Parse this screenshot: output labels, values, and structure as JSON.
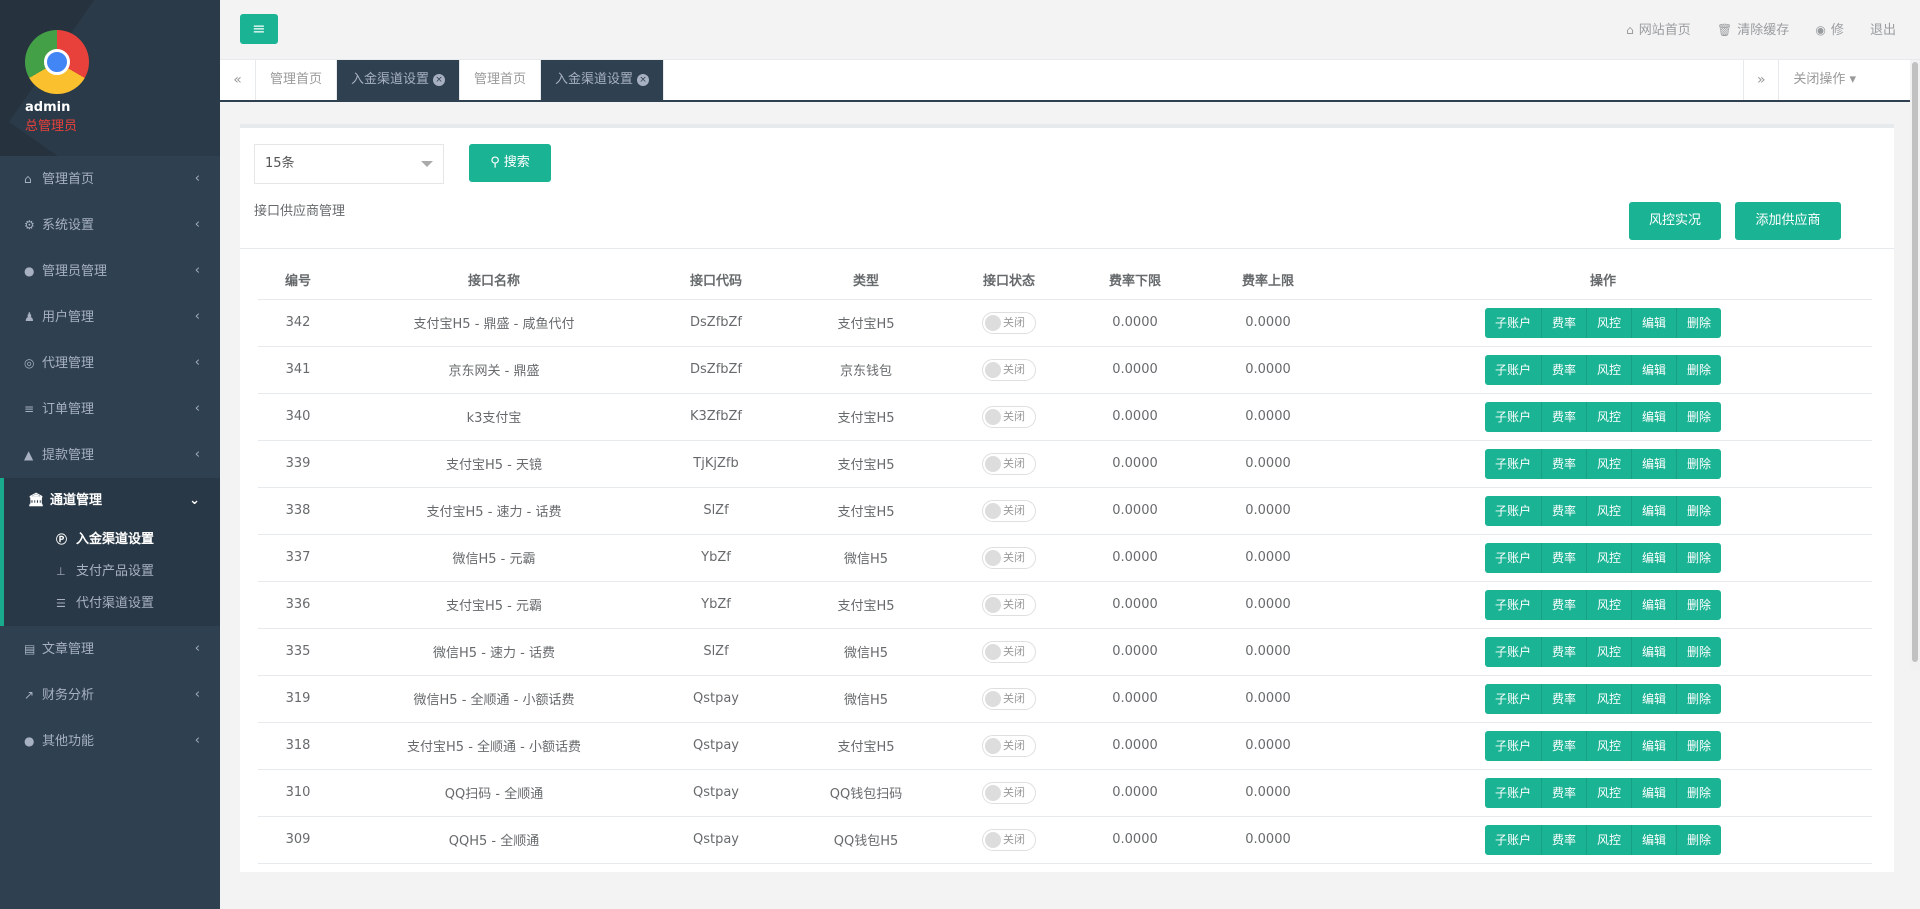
{
  "user": {
    "name": "admin",
    "role": "总管理员"
  },
  "sidebar": {
    "items_top": [
      {
        "label": "管理首页",
        "icon": "home-icon"
      },
      {
        "label": "系统设置",
        "icon": "cogs-icon"
      },
      {
        "label": "管理员管理",
        "icon": "user-circle-icon"
      },
      {
        "label": "用户管理",
        "icon": "users-icon"
      },
      {
        "label": "代理管理",
        "icon": "handshake-icon"
      },
      {
        "label": "订单管理",
        "icon": "list-icon"
      },
      {
        "label": "提款管理",
        "icon": "lock-icon"
      }
    ],
    "active": {
      "label": "通道管理",
      "icon": "bank-icon"
    },
    "sub_items": [
      {
        "label": "入金渠道设置",
        "icon": "paypal-icon"
      },
      {
        "label": "支付产品设置",
        "icon": "sitemap-icon"
      },
      {
        "label": "代付渠道设置",
        "icon": "sliders-icon"
      }
    ],
    "items_bottom": [
      {
        "label": "文章管理",
        "icon": "book-icon"
      },
      {
        "label": "财务分析",
        "icon": "chart-icon"
      },
      {
        "label": "其他功能",
        "icon": "user-circle-icon"
      }
    ]
  },
  "topbar": {
    "home": "网站首页",
    "clear_cache": "清除缓存",
    "edit": "修",
    "logout": "退出"
  },
  "tabs": [
    {
      "label": "管理首页",
      "active": false
    },
    {
      "label": "入金渠道设置",
      "active": true
    },
    {
      "label": "管理首页",
      "active": false
    },
    {
      "label": "入金渠道设置",
      "active": true
    }
  ],
  "tab_ops": "关闭操作",
  "filter": {
    "page_size": "15条",
    "search": "搜索"
  },
  "panel_title": "接口供应商管理",
  "buttons": {
    "risk": "风控实况",
    "add": "添加供应商"
  },
  "columns": [
    "编号",
    "接口名称",
    "接口代码",
    "类型",
    "接口状态",
    "费率下限",
    "费率上限",
    "操作"
  ],
  "status_label": "关闭",
  "actions": [
    "子账户",
    "费率",
    "风控",
    "编辑",
    "删除"
  ],
  "rows": [
    {
      "id": "342",
      "name": "支付宝H5 - 鼎盛 - 咸鱼代付",
      "code": "DsZfbZf",
      "type": "支付宝H5",
      "min": "0.0000",
      "max": "0.0000"
    },
    {
      "id": "341",
      "name": "京东网关 - 鼎盛",
      "code": "DsZfbZf",
      "type": "京东钱包",
      "min": "0.0000",
      "max": "0.0000"
    },
    {
      "id": "340",
      "name": "k3支付宝",
      "code": "K3ZfbZf",
      "type": "支付宝H5",
      "min": "0.0000",
      "max": "0.0000"
    },
    {
      "id": "339",
      "name": "支付宝H5 - 天镜",
      "code": "TjKjZfb",
      "type": "支付宝H5",
      "min": "0.0000",
      "max": "0.0000"
    },
    {
      "id": "338",
      "name": "支付宝H5 - 速力 - 话费",
      "code": "SlZf",
      "type": "支付宝H5",
      "min": "0.0000",
      "max": "0.0000"
    },
    {
      "id": "337",
      "name": "微信H5 - 元霸",
      "code": "YbZf",
      "type": "微信H5",
      "min": "0.0000",
      "max": "0.0000"
    },
    {
      "id": "336",
      "name": "支付宝H5 - 元霸",
      "code": "YbZf",
      "type": "支付宝H5",
      "min": "0.0000",
      "max": "0.0000"
    },
    {
      "id": "335",
      "name": "微信H5 - 速力 - 话费",
      "code": "SlZf",
      "type": "微信H5",
      "min": "0.0000",
      "max": "0.0000"
    },
    {
      "id": "319",
      "name": "微信H5 - 全顺通 - 小额话费",
      "code": "Qstpay",
      "type": "微信H5",
      "min": "0.0000",
      "max": "0.0000"
    },
    {
      "id": "318",
      "name": "支付宝H5 - 全顺通 - 小额话费",
      "code": "Qstpay",
      "type": "支付宝H5",
      "min": "0.0000",
      "max": "0.0000"
    },
    {
      "id": "310",
      "name": "QQ扫码 - 全顺通",
      "code": "Qstpay",
      "type": "QQ钱包扫码",
      "min": "0.0000",
      "max": "0.0000"
    },
    {
      "id": "309",
      "name": "QQH5 - 全顺通",
      "code": "Qstpay",
      "type": "QQ钱包H5",
      "min": "0.0000",
      "max": "0.0000"
    }
  ]
}
